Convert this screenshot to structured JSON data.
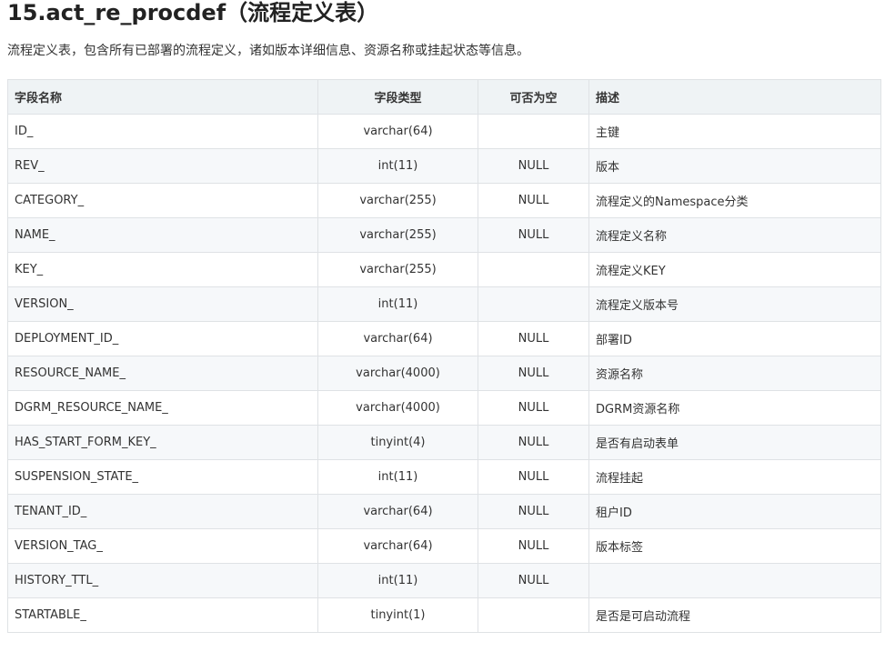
{
  "heading": "15.act_re_procdef（流程定义表）",
  "intro": "流程定义表，包含所有已部署的流程定义，诸如版本详细信息、资源名称或挂起状态等信息。",
  "table": {
    "headers": [
      "字段名称",
      "字段类型",
      "可否为空",
      "描述"
    ],
    "rows": [
      [
        "ID_",
        "varchar(64)",
        "",
        "主键"
      ],
      [
        "REV_",
        "int(11)",
        "NULL",
        "版本"
      ],
      [
        "CATEGORY_",
        "varchar(255)",
        "NULL",
        "流程定义的Namespace分类"
      ],
      [
        "NAME_",
        "varchar(255)",
        "NULL",
        "流程定义名称"
      ],
      [
        "KEY_",
        "varchar(255)",
        "",
        "流程定义KEY"
      ],
      [
        "VERSION_",
        "int(11)",
        "",
        "流程定义版本号"
      ],
      [
        "DEPLOYMENT_ID_",
        "varchar(64)",
        "NULL",
        "部署ID"
      ],
      [
        "RESOURCE_NAME_",
        "varchar(4000)",
        "NULL",
        "资源名称"
      ],
      [
        "DGRM_RESOURCE_NAME_",
        "varchar(4000)",
        "NULL",
        "DGRM资源名称"
      ],
      [
        "HAS_START_FORM_KEY_",
        "tinyint(4)",
        "NULL",
        "是否有启动表单"
      ],
      [
        "SUSPENSION_STATE_",
        "int(11)",
        "NULL",
        "流程挂起"
      ],
      [
        "TENANT_ID_",
        "varchar(64)",
        "NULL",
        "租户ID"
      ],
      [
        "VERSION_TAG_",
        "varchar(64)",
        "NULL",
        "版本标签"
      ],
      [
        "HISTORY_TTL_",
        "int(11)",
        "NULL",
        ""
      ],
      [
        "STARTABLE_",
        "tinyint(1)",
        "",
        "是否是可启动流程"
      ]
    ]
  }
}
